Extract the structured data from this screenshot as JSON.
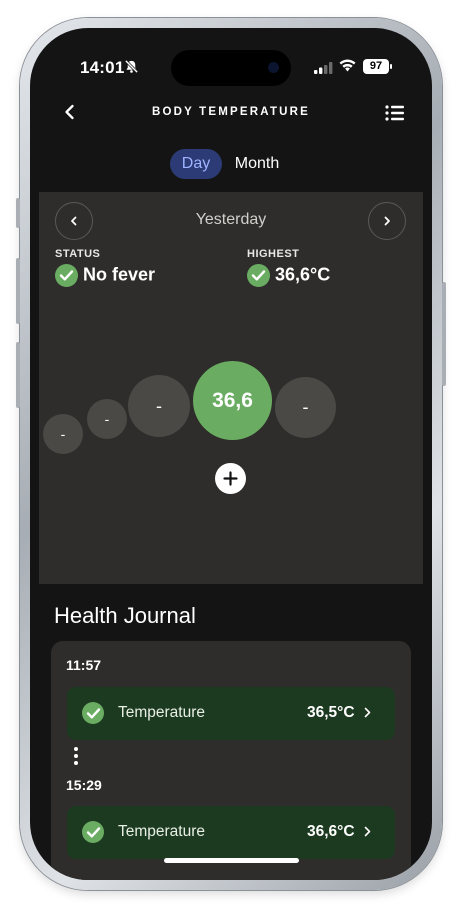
{
  "status_bar": {
    "time": "14:01",
    "battery": "97"
  },
  "header": {
    "title": "BODY TEMPERATURE"
  },
  "segmented": {
    "day": "Day",
    "month": "Month",
    "selected": "Day"
  },
  "day_view": {
    "date": "Yesterday",
    "status": {
      "label": "STATUS",
      "value": "No fever"
    },
    "highest": {
      "label": "HIGHEST",
      "value": "36,6°C"
    },
    "readings": [
      "-",
      "-",
      "-",
      "36,6",
      "-"
    ]
  },
  "journal": {
    "title": "Health Journal",
    "entries": [
      {
        "time": "11:57",
        "label": "Temperature",
        "value": "36,5°C"
      },
      {
        "time": "15:29",
        "label": "Temperature",
        "value": "36,6°C"
      }
    ]
  },
  "colors": {
    "accent_green": "#6aad62",
    "entry_bg": "#1c3a1f",
    "day_pill": "#2c3b75",
    "panel": "#2e2d2b"
  }
}
